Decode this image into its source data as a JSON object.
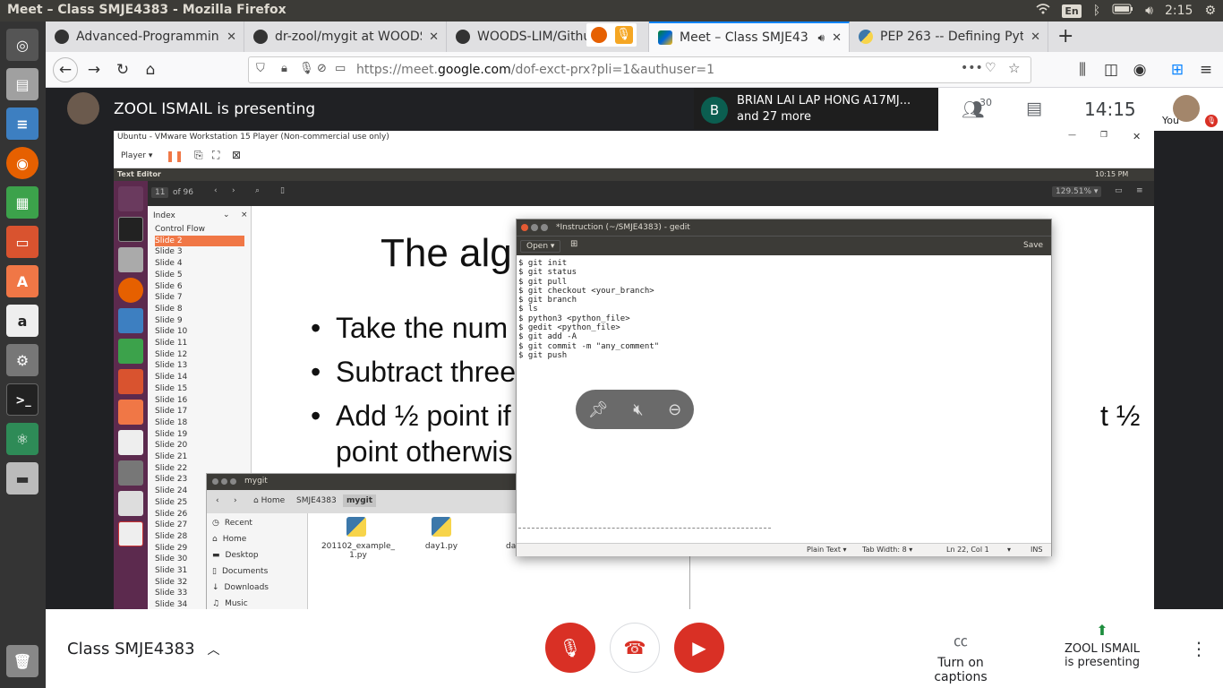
{
  "os": {
    "window_title": "Meet – Class SMJE4383 - Mozilla Firefox",
    "lang": "En",
    "time": "2:15"
  },
  "browser": {
    "tabs": [
      {
        "label": "Advanced-Programming",
        "favicon": "github-icon",
        "active": false
      },
      {
        "label": "dr-zool/mygit at WOODS",
        "favicon": "github-icon",
        "active": false
      },
      {
        "label": "WOODS-LIM/Github",
        "favicon": "github-icon",
        "active": false
      },
      {
        "label": "Meet – Class SMJE43",
        "favicon": "meet-icon",
        "active": true
      },
      {
        "label": "PEP 263 -- Defining Pyth",
        "favicon": "python-icon",
        "active": false
      }
    ],
    "url_prefix": "https://meet.",
    "url_domain": "google.com",
    "url_path": "/dof-exct-prx?pli=1&authuser=1"
  },
  "meet": {
    "presenter_text": "ZOOL ISMAIL is presenting",
    "chip_initial": "B",
    "chip_name": "BRIAN LAI LAP HONG A17MJ...",
    "chip_more": "and 27 more",
    "participants_count": "30",
    "clock": "14:15",
    "you_label": "You",
    "meeting_name": "Class SMJE4383",
    "captions_label": "Turn on captions",
    "presenting_line1": "ZOOL ISMAIL",
    "presenting_line2": "is presenting"
  },
  "vm": {
    "title": "Ubuntu - VMware Workstation 15 Player (Non-commercial use only)",
    "player_menu": "Player ▾",
    "app_name": "Text Editor",
    "clock": "10:15 PM",
    "page_current": "11",
    "page_total": "of 96",
    "zoom": "129.51% ▾",
    "index_title": "Index",
    "slides": [
      "Control Flow",
      "Slide 2",
      "Slide 3",
      "Slide 4",
      "Slide 5",
      "Slide 6",
      "Slide 7",
      "Slide 8",
      "Slide 9",
      "Slide 10",
      "Slide 11",
      "Slide 12",
      "Slide 13",
      "Slide 14",
      "Slide 15",
      "Slide 16",
      "Slide 17",
      "Slide 18",
      "Slide 19",
      "Slide 20",
      "Slide 21",
      "Slide 22",
      "Slide 23",
      "Slide 24",
      "Slide 25",
      "Slide 26",
      "Slide 27",
      "Slide 28",
      "Slide 29",
      "Slide 30",
      "Slide 31",
      "Slide 32",
      "Slide 33",
      "Slide 34"
    ],
    "slide_heading": "The alg",
    "slide_bullets": [
      "Take the num",
      "Subtract three",
      "Add ½ point if",
      "point otherwis"
    ],
    "slide_right_frag": "t ½"
  },
  "gedit": {
    "title": "*Instruction (~/SMJE4383) - gedit",
    "open_label": "Open ▾",
    "save_label": "Save",
    "content": "$ git init\n$ git status\n$ git pull\n$ git checkout <your_branch>\n$ git branch\n$ ls\n$ python3 <python_file>\n$ gedit <python_file>\n$ git add -A\n$ git commit -m \"any_comment\"\n$ git push",
    "status_lang": "Plain Text ▾",
    "status_tab": "Tab Width: 8 ▾",
    "status_pos": "Ln 22, Col 1",
    "status_ins": "INS"
  },
  "files": {
    "title": "mygit",
    "crumbs": [
      "Home",
      "SMJE4383",
      "mygit"
    ],
    "sidebar": [
      "Recent",
      "Home",
      "Desktop",
      "Documents",
      "Downloads",
      "Music"
    ],
    "items": [
      "201102_example_1.py",
      "day1.py",
      "da"
    ]
  },
  "colors": {
    "meet_red": "#d93025",
    "slide_select": "#f07746",
    "ubuntu_dark": "#3c3b37"
  }
}
